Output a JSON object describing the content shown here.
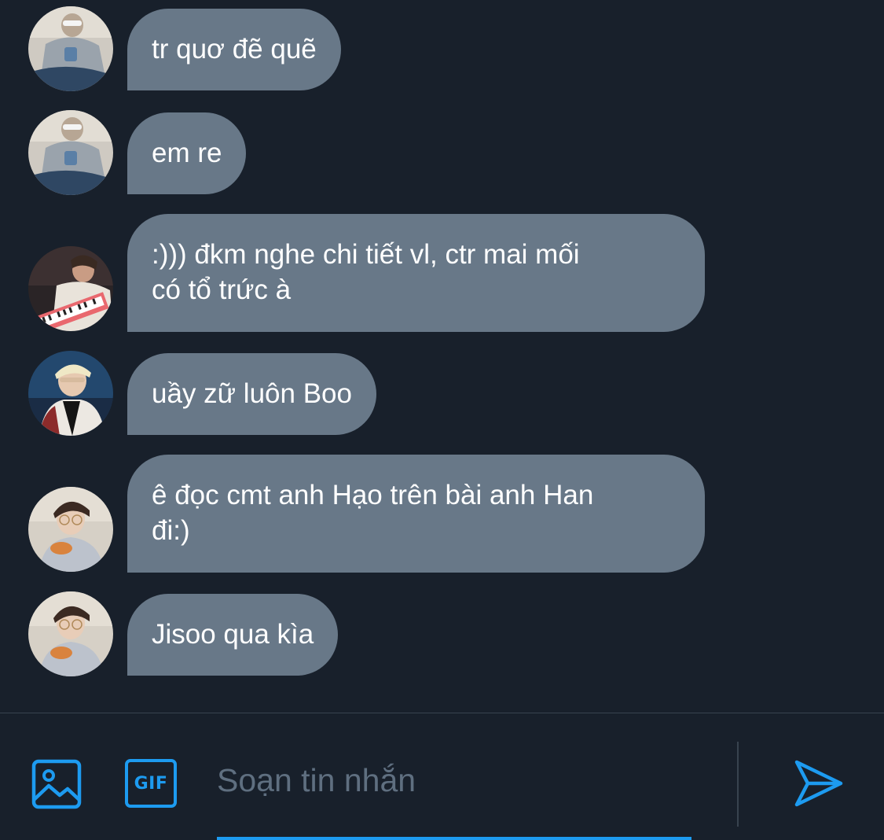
{
  "messages": [
    {
      "text": "tr quơ đẽ quẽ",
      "avatar": "hoodie-sitting-avatar"
    },
    {
      "text": "em re",
      "avatar": "hoodie-sitting-avatar"
    },
    {
      "text": ":))) đkm nghe chi tiết vl, ctr mai mối\ncó tổ trức à",
      "avatar": "keyboard-player-avatar"
    },
    {
      "text": "uầy zữ luôn Boo",
      "avatar": "blonde-jacket-avatar"
    },
    {
      "text": "ê đọc cmt anh Hạo trên bài anh Han\nđi:)",
      "avatar": "glasses-eating-avatar"
    },
    {
      "text": "Jisoo qua kìa",
      "avatar": "glasses-eating-avatar"
    }
  ],
  "composer": {
    "placeholder": "Soạn tin nhắn",
    "gif_label": "GIF",
    "icons": {
      "image": "image-icon",
      "gif": "gif-icon",
      "send": "send-icon"
    }
  },
  "colors": {
    "background": "#18202b",
    "bubble": "#687888",
    "accent": "#1d9bf0",
    "placeholder": "#5f6f80"
  }
}
